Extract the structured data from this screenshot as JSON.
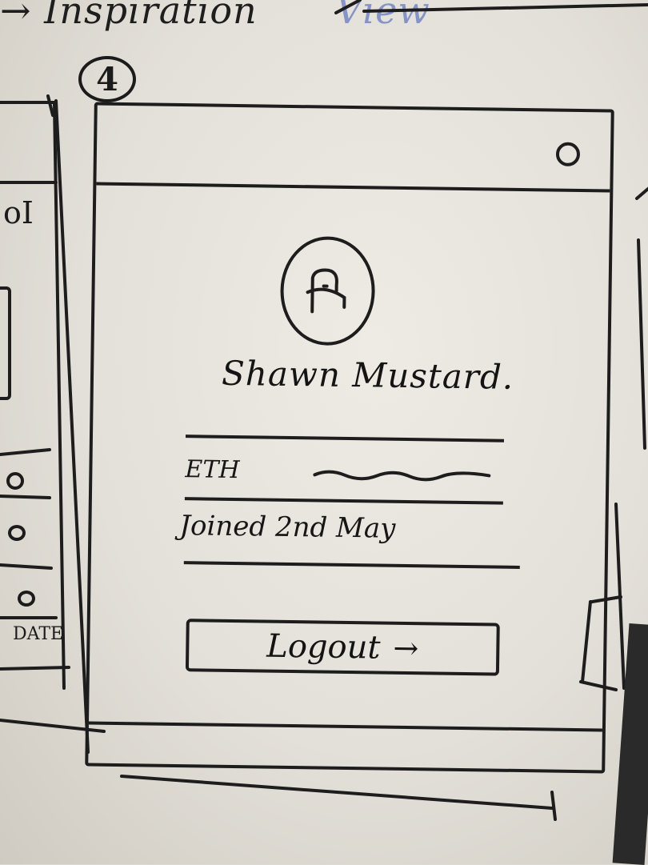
{
  "board": {
    "top_left_text": "→ Inspiration",
    "top_right_text": "View"
  },
  "step_badge": "4",
  "left_frame": {
    "label_top": "oI",
    "label_date": "DATE"
  },
  "profile": {
    "user_name": "Shawn Mustard.",
    "fields": [
      {
        "label": "ETH"
      },
      {
        "label": "Joined 2nd May"
      }
    ],
    "logout_label": "Logout",
    "logout_icon": "→"
  },
  "icons": {
    "settings": "settings-circle-icon",
    "avatar": "user-avatar-icon",
    "logout": "logout-arrow-icon"
  }
}
